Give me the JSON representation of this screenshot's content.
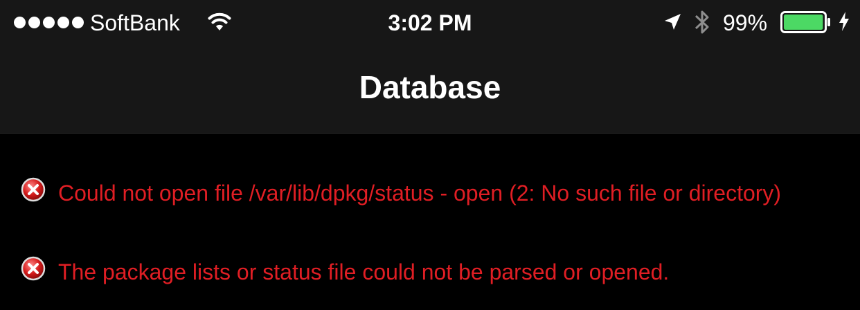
{
  "status_bar": {
    "carrier": "SoftBank",
    "signal_bars": 5,
    "time": "3:02 PM",
    "battery_percent": "99%",
    "battery_level": 0.99,
    "battery_color": "#4cd964",
    "icons": [
      "signal-dots-icon",
      "wifi-icon",
      "location-arrow-icon",
      "bluetooth-icon",
      "battery-icon",
      "charging-bolt-icon"
    ]
  },
  "nav": {
    "title": "Database"
  },
  "errors": [
    {
      "icon": "error-x-icon",
      "text": "Could not open file /var/lib/dpkg/status - open (2: No such file or directory)"
    },
    {
      "icon": "error-x-icon",
      "text": "The package lists or status file could not be parsed or opened."
    }
  ],
  "colors": {
    "background": "#000000",
    "header": "#171717",
    "error_text": "#e01e24"
  }
}
